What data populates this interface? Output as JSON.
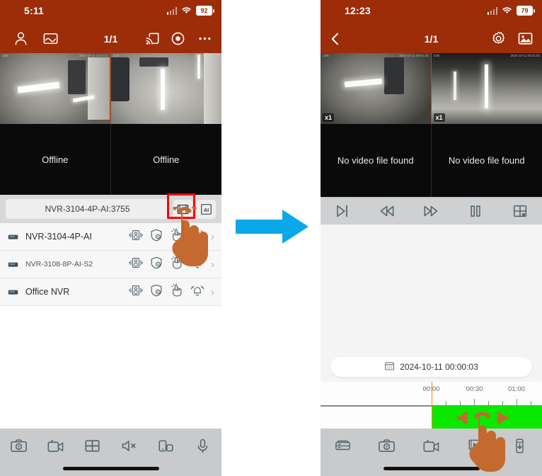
{
  "colors": {
    "header": "#9c2d08",
    "accent_green": "#0ae800",
    "accent_orange": "#f0881b",
    "arrow_blue": "#0aa8e8",
    "highlight_red": "#fe0000",
    "hand": "#c4692f"
  },
  "left_phone": {
    "status": {
      "time": "5:11",
      "battery": "92",
      "signal_icon": "cellular-signal-icon",
      "wifi_icon": "wifi-icon"
    },
    "appbar": {
      "user_icon": "user-account-icon",
      "image_icon": "image-gallery-icon",
      "page_indicator": "1/1",
      "cast_icon": "screen-cast-icon",
      "eye_icon": "eye-preview-icon",
      "more_icon": "more-options-icon"
    },
    "video_cells": [
      {
        "label": "",
        "state": "live",
        "selected": true,
        "stamp_left": "1/05",
        "stamp_right": "2024-10-11 11:11:21"
      },
      {
        "label": "",
        "state": "live",
        "selected": false,
        "stamp_left": "1/06",
        "stamp_right": "2024-10-11 01:23"
      },
      {
        "label": "Offline",
        "state": "offline",
        "selected": false
      },
      {
        "label": "Offline",
        "state": "offline",
        "selected": false
      }
    ],
    "searchbar": {
      "field_value": "NVR-3104-4P-AI:3755",
      "field_placeholder": "Search device",
      "playback_button_icon": "film-playback-icon",
      "ai_button_label": "AI"
    },
    "devices": [
      {
        "name": "NVR-3104-4P-AI",
        "small": false,
        "device_icon": "nvr-device-icon",
        "actions": [
          "two-way-audio-icon",
          "shield-settings-icon",
          "manual-trigger-icon",
          "alarm-bell-icon"
        ],
        "chevron": "›"
      },
      {
        "name": "NVR-3108-8P-AI-S2",
        "small": true,
        "device_icon": "nvr-device-icon",
        "actions": [
          "two-way-audio-icon",
          "shield-settings-icon",
          "manual-trigger-icon",
          "alarm-bell-icon"
        ],
        "chevron": "›"
      },
      {
        "name": "Office NVR",
        "small": false,
        "device_icon": "nvr-device-icon",
        "actions": [
          "two-way-audio-icon",
          "shield-settings-icon",
          "manual-trigger-icon",
          "alarm-bell-icon"
        ],
        "chevron": "›"
      }
    ],
    "bottombar": [
      {
        "icon": "snapshot-camera-icon",
        "label": ""
      },
      {
        "icon": "record-video-icon",
        "label": ""
      },
      {
        "icon": "grid-layout-icon",
        "label": ""
      },
      {
        "icon": "speaker-muted-icon",
        "label": ""
      },
      {
        "icon": "screen-rotate-icon",
        "label": ""
      },
      {
        "icon": "microphone-icon",
        "label": ""
      }
    ]
  },
  "right_phone": {
    "status": {
      "time": "12:23",
      "battery": "79",
      "signal_icon": "cellular-signal-icon",
      "wifi_icon": "wifi-icon"
    },
    "appbar": {
      "back_icon": "back-chevron-icon",
      "page_indicator": "1/1",
      "settings_icon": "gear-settings-icon",
      "image_icon": "image-gallery-icon"
    },
    "video_cells": [
      {
        "label": "",
        "state": "live",
        "selected": true,
        "zoom_tag": "x1",
        "stamp_left": "1/05",
        "stamp_right": "2024-10-11 00:01:15"
      },
      {
        "label": "",
        "state": "live",
        "selected": false,
        "zoom_tag": "x1",
        "stamp_left": "1/06",
        "stamp_right": "2024-10-11 00:01:03"
      },
      {
        "label": "No video file found",
        "state": "novideo",
        "selected": false
      },
      {
        "label": "No video file found",
        "state": "novideo",
        "selected": false
      }
    ],
    "playback_controls": [
      {
        "icon": "step-frame-icon"
      },
      {
        "icon": "rewind-icon"
      },
      {
        "icon": "fast-forward-icon"
      },
      {
        "icon": "pause-icon"
      },
      {
        "icon": "grid-layout-icon"
      }
    ],
    "date_picker": {
      "calendar_icon": "calendar-icon",
      "value": "2024-10-11 00:00:03"
    },
    "timeline": {
      "labels": [
        {
          "text": "00:00",
          "left_pct": 50.0
        },
        {
          "text": "00:30",
          "left_pct": 69.5
        },
        {
          "text": "01:00",
          "left_pct": 88.5
        }
      ],
      "ticks_pct": [
        56.5,
        62.8,
        69.3,
        75.6,
        82.0,
        88.4,
        94.8,
        100.0
      ],
      "playhead_pct": 50.0,
      "recording_start_pct": 50.0,
      "recording_end_pct": 100.0,
      "recording_color": "#0ae800"
    },
    "bottombar": [
      {
        "icon": "nvr-storage-icon"
      },
      {
        "icon": "snapshot-camera-icon"
      },
      {
        "icon": "record-video-icon"
      },
      {
        "icon": "video-clip-filter-icon"
      },
      {
        "icon": "usb-download-icon"
      }
    ]
  },
  "transition": {
    "arrow_icon": "right-arrow-icon"
  },
  "cursors": [
    {
      "name": "tap-hand-cursor-left",
      "target": "film-playback-icon"
    },
    {
      "name": "tap-hand-cursor-right",
      "target": "timeline-drag-handle"
    }
  ]
}
